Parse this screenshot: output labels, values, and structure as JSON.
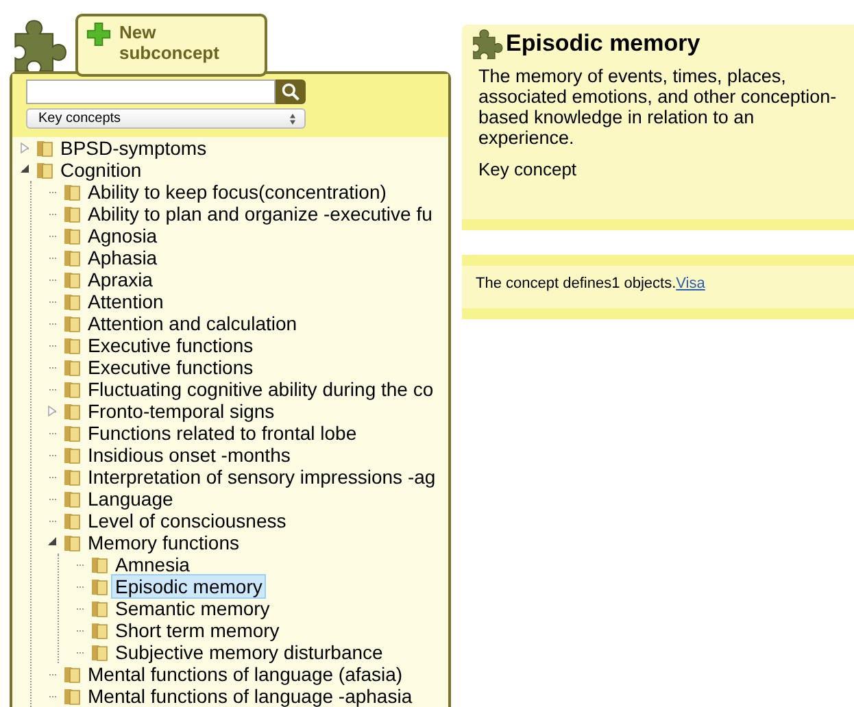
{
  "new_button": {
    "label": "New subconcept"
  },
  "filter": {
    "value": "Key concepts"
  },
  "tree": [
    {
      "label": "BPSD-symptoms",
      "expanded": false,
      "selected": false
    },
    {
      "label": "Cognition",
      "expanded": true,
      "selected": false,
      "children": [
        {
          "label": "Ability to keep focus(concentration)",
          "selected": false
        },
        {
          "label": "Ability to plan and organize -executive fu",
          "selected": false
        },
        {
          "label": "Agnosia",
          "selected": false
        },
        {
          "label": "Aphasia",
          "selected": false
        },
        {
          "label": "Apraxia",
          "selected": false
        },
        {
          "label": "Attention",
          "selected": false
        },
        {
          "label": "Attention and calculation",
          "selected": false
        },
        {
          "label": "Executive functions",
          "selected": false
        },
        {
          "label": "Executive functions",
          "selected": false
        },
        {
          "label": "Fluctuating cognitive ability during the co",
          "selected": false
        },
        {
          "label": "Fronto-temporal signs",
          "expanded": false,
          "selected": false
        },
        {
          "label": "Functions related to frontal lobe",
          "selected": false
        },
        {
          "label": "Insidious onset -months",
          "selected": false
        },
        {
          "label": "Interpretation of sensory impressions -ag",
          "selected": false
        },
        {
          "label": "Language",
          "selected": false
        },
        {
          "label": "Level of consciousness",
          "selected": false
        },
        {
          "label": "Memory functions",
          "expanded": true,
          "selected": false,
          "children": [
            {
              "label": "Amnesia",
              "selected": false
            },
            {
              "label": "Episodic memory",
              "selected": true
            },
            {
              "label": "Semantic memory",
              "selected": false
            },
            {
              "label": "Short term memory",
              "selected": false
            },
            {
              "label": "Subjective memory disturbance",
              "selected": false
            }
          ]
        },
        {
          "label": "Mental functions of language (afasia)",
          "selected": false
        },
        {
          "label": "Mental functions of language -aphasia",
          "selected": false
        }
      ]
    }
  ],
  "detail": {
    "title": "Episodic memory",
    "description": "The memory of events, times, places, associated emotions, and other conception-based knowledge in relation to an experience.",
    "category": "Key concept"
  },
  "objects": {
    "text": "The concept defines1 objects.",
    "link": "Visa"
  }
}
